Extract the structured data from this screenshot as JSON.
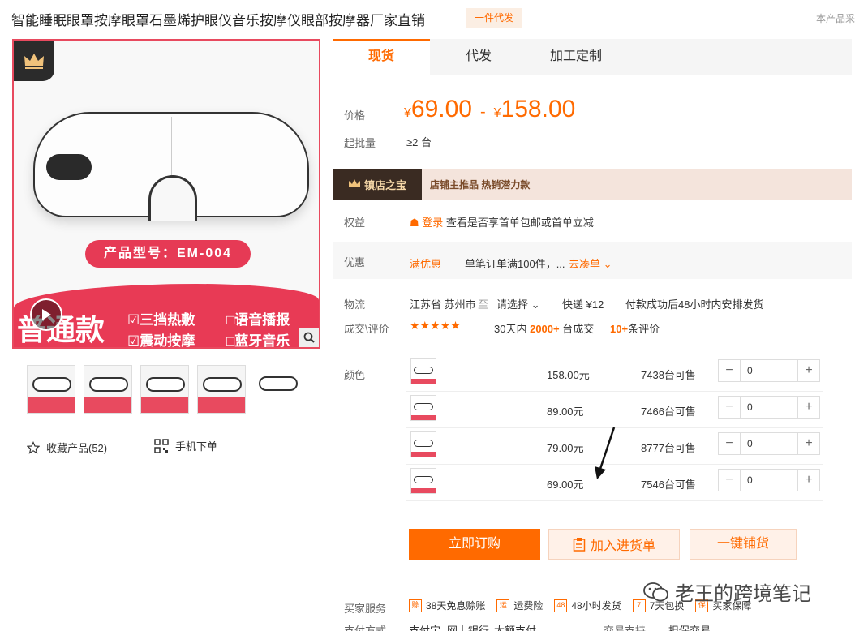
{
  "header": {
    "title": "智能睡眠眼罩按摩眼罩石墨烯护眼仪音乐按摩仪眼部按摩器厂家直销",
    "badge": "一件代发",
    "corner_text": "本产品采"
  },
  "gallery": {
    "model_label": "产品型号：EM-004",
    "variant_label": "普通款",
    "features": [
      "☑三挡热敷",
      "□语音播报",
      "☑震动按摩",
      "□蓝牙音乐"
    ],
    "thumb_count": 5
  },
  "actions": {
    "favorite": "收藏产品(52)",
    "mobile_order": "手机下单"
  },
  "tabs": [
    "现货",
    "代发",
    "加工定制"
  ],
  "price": {
    "label": "价格",
    "currency": "¥",
    "min": "69.00",
    "max": "158.00"
  },
  "moq": {
    "label": "起批量",
    "value": "≥2 台"
  },
  "treasure": {
    "tag": "镇店之宝",
    "text": "店铺主推品  热销潜力款"
  },
  "benefits": {
    "label": "权益",
    "login": "登录",
    "text": "查看是否享首单包邮或首单立减"
  },
  "promo": {
    "label": "优惠",
    "tag": "满优惠",
    "text": "单笔订单满100件，...",
    "link": "去凑单"
  },
  "logistics": {
    "label": "物流",
    "from": "江苏省 苏州市",
    "to_word": "至",
    "select": "请选择",
    "express": "快递 ¥12",
    "ship": "付款成功后48小时内安排发货"
  },
  "reviews": {
    "label": "成交\\评价",
    "stars": "★★★★★",
    "deals_pre": "30天内",
    "deals_num": "2000+",
    "deals_post": "台成交",
    "reviews_num": "10+",
    "reviews_post": "条评价"
  },
  "color_label": "颜色",
  "skus": [
    {
      "price": "158.00元",
      "stock": "7438台可售",
      "qty": "0"
    },
    {
      "price": "89.00元",
      "stock": "7466台可售",
      "qty": "0"
    },
    {
      "price": "79.00元",
      "stock": "8777台可售",
      "qty": "0"
    },
    {
      "price": "69.00元",
      "stock": "7546台可售",
      "qty": "0"
    }
  ],
  "buttons": {
    "order": "立即订购",
    "cart": "加入进货单",
    "onekey": "一键铺货"
  },
  "services": {
    "label": "买家服务",
    "items": [
      "38天免息赊账",
      "运费险",
      "48小时发货",
      "7天包换",
      "买家保障"
    ]
  },
  "payment": {
    "label": "支付方式",
    "items": [
      "支付宝",
      "网上银行",
      "大额支付"
    ],
    "trade_label": "交易支持",
    "trade_value": "担保交易"
  },
  "watermark": "老王的跨境笔记",
  "colors": {
    "accent": "#ff6a00",
    "brand_red": "#e84a5f"
  }
}
